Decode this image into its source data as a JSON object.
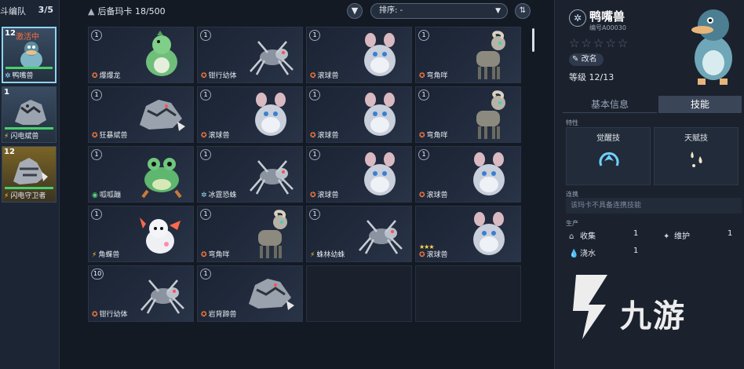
{
  "team": {
    "title": "斗编队",
    "count": "3/5",
    "members": [
      {
        "level": "12",
        "status": "激活中",
        "name": "鸭嘴兽",
        "icon": "snowflake-icon"
      },
      {
        "level": "1",
        "status": "",
        "name": "闪电斌兽",
        "icon": "bolt-icon"
      },
      {
        "level": "12",
        "status": "",
        "name": "闪电守卫者",
        "icon": "bolt-icon"
      }
    ]
  },
  "toolbar": {
    "stock_label": "后备玛卡 18/500",
    "sort_label": "排序: -",
    "filter_icon": "filter-icon",
    "sort_order_icon": "sort-order-icon"
  },
  "cards": [
    {
      "level": "1",
      "name": "爆爆龙",
      "element": "fire",
      "art": "dino",
      "stars": ""
    },
    {
      "level": "1",
      "name": "钳行幼体",
      "element": "fire",
      "art": "spider",
      "stars": ""
    },
    {
      "level": "1",
      "name": "滚球兽",
      "element": "fire",
      "art": "mouse",
      "stars": ""
    },
    {
      "level": "1",
      "name": "弯角咩",
      "element": "fire",
      "art": "goat",
      "stars": ""
    },
    {
      "level": "1",
      "name": "狂暴斌兽",
      "element": "fire",
      "art": "beast",
      "stars": ""
    },
    {
      "level": "1",
      "name": "滚球兽",
      "element": "fire",
      "art": "mouse",
      "stars": ""
    },
    {
      "level": "1",
      "name": "滚球兽",
      "element": "fire",
      "art": "mouse",
      "stars": ""
    },
    {
      "level": "1",
      "name": "弯角咩",
      "element": "fire",
      "art": "goat",
      "stars": ""
    },
    {
      "level": "1",
      "name": "呱呱蹦",
      "element": "leaf",
      "art": "frog",
      "stars": ""
    },
    {
      "level": "1",
      "name": "冰霆恐蛛",
      "element": "snow",
      "art": "spider",
      "stars": ""
    },
    {
      "level": "1",
      "name": "滚球兽",
      "element": "fire",
      "art": "mouse",
      "stars": ""
    },
    {
      "level": "1",
      "name": "滚球兽",
      "element": "fire",
      "art": "mouse",
      "stars": ""
    },
    {
      "level": "1",
      "name": "角蝶兽",
      "element": "bolt",
      "art": "axolotl",
      "stars": ""
    },
    {
      "level": "1",
      "name": "弯角咩",
      "element": "fire",
      "art": "goat",
      "stars": ""
    },
    {
      "level": "1",
      "name": "蛛林幼蛛",
      "element": "bolt",
      "art": "spider",
      "stars": ""
    },
    {
      "level": "",
      "name": "滚球兽",
      "element": "fire",
      "art": "mouse",
      "stars": "★★★"
    },
    {
      "level": "10",
      "name": "钳行幼体",
      "element": "fire",
      "art": "spider",
      "stars": ""
    },
    {
      "level": "1",
      "name": "岩背蹄兽",
      "element": "fire",
      "art": "beast",
      "stars": ""
    }
  ],
  "detail": {
    "name": "鸭嘴兽",
    "id": "编号A00030",
    "stars": "☆☆☆☆☆",
    "rename_label": "改名",
    "level_label": "等级 12/13",
    "tab_basic": "基本信息",
    "tab_skill": "技能",
    "trait_label": "特性",
    "awaken_label": "觉醒技",
    "talent_label": "天赋技",
    "link_label": "连携",
    "link_text": "该玛卡不具备连携技能",
    "produce_label": "生产",
    "produce": [
      {
        "name": "收集",
        "value": "1",
        "icon": "basket-icon"
      },
      {
        "name": "维护",
        "value": "1",
        "icon": "wrench-icon"
      },
      {
        "name": "浇水",
        "value": "1",
        "icon": "water-drop-icon"
      }
    ]
  },
  "watermark": "九游",
  "colors": {
    "accent": "#8fd3f0",
    "fire": "#ff7a3a",
    "bolt": "#ffd34a",
    "snow": "#9fdcff",
    "leaf": "#59d27a"
  }
}
